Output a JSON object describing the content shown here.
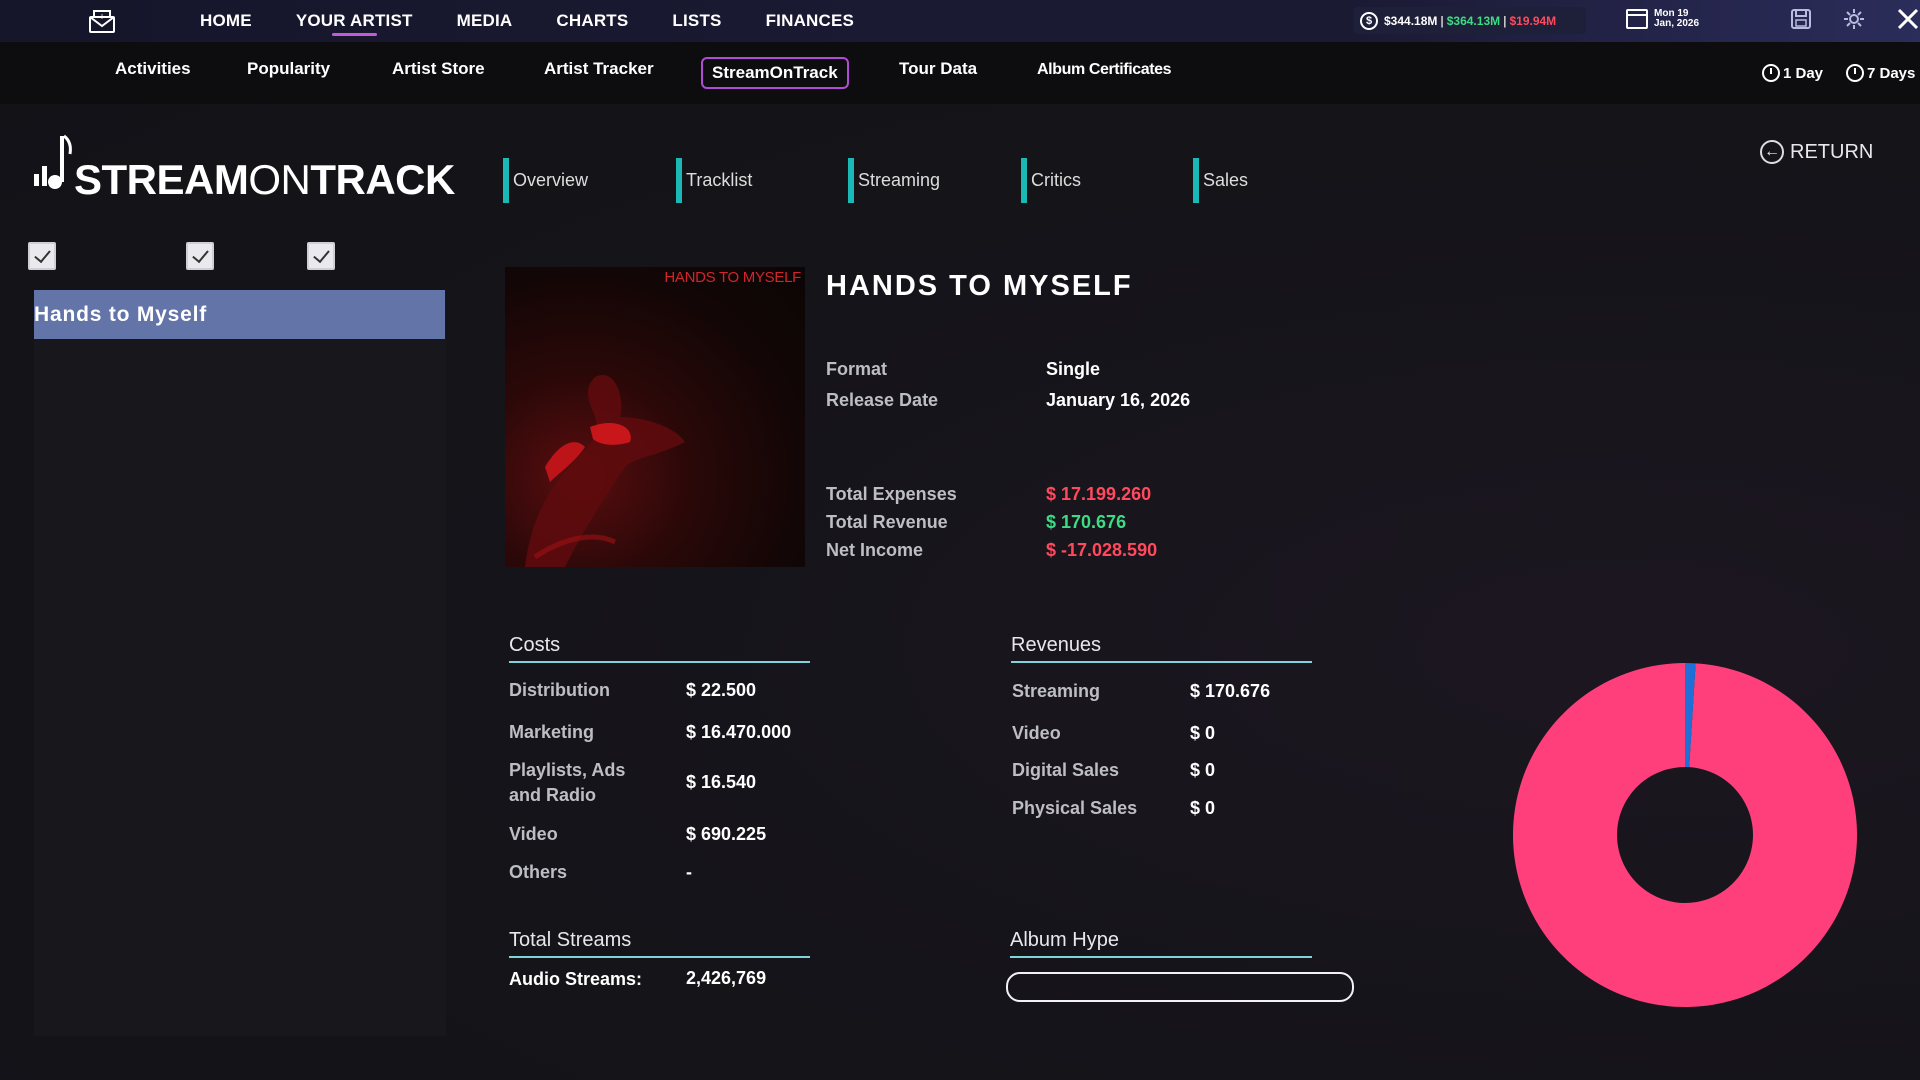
{
  "topnav": {
    "items": [
      "HOME",
      "YOUR ARTIST",
      "MEDIA",
      "CHARTS",
      "LISTS",
      "FINANCES"
    ],
    "active": "YOUR ARTIST",
    "money": {
      "total": "$344.18M",
      "income": "$364.13M",
      "expense": "$19.94M"
    },
    "date_line1": "Mon 19",
    "date_line2": "Jan, 2026"
  },
  "subnav": {
    "items": [
      "Activities",
      "Popularity",
      "Artist Store",
      "Artist Tracker",
      "StreamOnTrack",
      "Tour Data",
      "Album Certificates"
    ],
    "active": "StreamOnTrack",
    "time_1day": "1 Day",
    "time_7days": "7 Days"
  },
  "logo": {
    "part1": "STREAM",
    "part2": "ON",
    "part3": "TRACK"
  },
  "sidebar": {
    "selected_release": "Hands to Myself"
  },
  "tabs": [
    "Overview",
    "Tracklist",
    "Streaming",
    "Critics",
    "Sales"
  ],
  "return_label": "RETURN",
  "release": {
    "cover_text": "HANDS TO MYSELF",
    "title": "HANDS TO MYSELF",
    "format_label": "Format",
    "format": "Single",
    "release_date_label": "Release Date",
    "release_date": "January 16, 2026",
    "total_expenses_label": "Total Expenses",
    "total_expenses": "$ 17.199.260",
    "total_revenue_label": "Total Revenue",
    "total_revenue": "$ 170.676",
    "net_income_label": "Net Income",
    "net_income": "$ -17.028.590"
  },
  "costs": {
    "heading": "Costs",
    "rows": [
      {
        "label": "Distribution",
        "value": "$ 22.500"
      },
      {
        "label": "Marketing",
        "value": "$ 16.470.000"
      },
      {
        "label": "Playlists, Ads and Radio",
        "value": "$ 16.540"
      },
      {
        "label": "Video",
        "value": "$ 690.225"
      },
      {
        "label": "Others",
        "value": "-"
      }
    ]
  },
  "revenues": {
    "heading": "Revenues",
    "rows": [
      {
        "label": "Streaming",
        "value": "$ 170.676"
      },
      {
        "label": "Video",
        "value": "$ 0"
      },
      {
        "label": "Digital Sales",
        "value": "$ 0"
      },
      {
        "label": "Physical Sales",
        "value": "$ 0"
      }
    ]
  },
  "streams": {
    "heading": "Total Streams",
    "label": "Audio Streams:",
    "value": "2,426,769"
  },
  "hype": {
    "heading": "Album Hype",
    "level": 0
  },
  "colors": {
    "accent_tab": "#1bb9b5",
    "active_border": "#b04bd3",
    "donut_main": "#ff3f7c",
    "donut_slice": "#1e6fd6",
    "positive": "#3ddc84",
    "negative": "#ff4a5e"
  },
  "chart_data": {
    "type": "pie",
    "categories": [
      "Total Expenses",
      "Total Revenue"
    ],
    "values": [
      17199260,
      170676
    ]
  }
}
